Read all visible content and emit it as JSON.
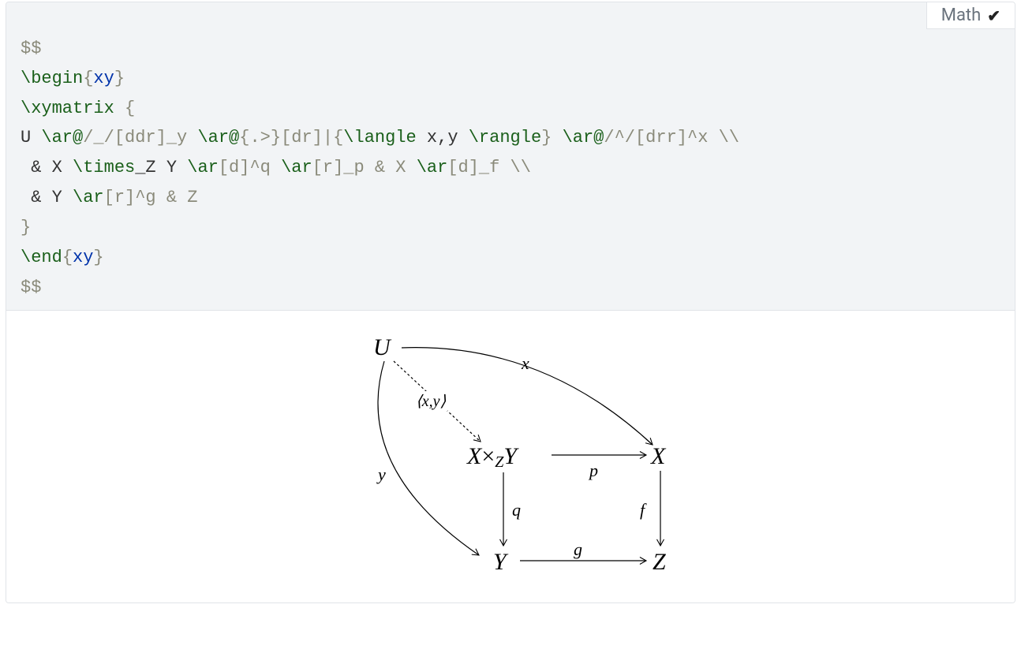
{
  "tab": {
    "label": "Math",
    "check": "✔"
  },
  "code": {
    "l1": "$$",
    "l2_begin": "\\begin",
    "l2_brace_o": "{",
    "l2_env": "xy",
    "l2_brace_c": "}",
    "l3_cmd": "\\xymatrix ",
    "l3_brace_o": "{",
    "l4_a": "U ",
    "l4_cmd1": "\\ar@",
    "l4_b": "/_/[ddr]_y ",
    "l4_cmd2": "\\ar@",
    "l4_c": "{.>}[dr]|{",
    "l4_cmd3": "\\langle",
    "l4_d": " x,y ",
    "l4_cmd4": "\\rangle",
    "l4_e": "} ",
    "l4_cmd5": "\\ar@",
    "l4_f": "/^/[drr]^x ",
    "l4_bs": "\\\\",
    "l5_a": " & X ",
    "l5_cmd1": "\\times",
    "l5_b": "_Z Y ",
    "l5_cmd2": "\\ar",
    "l5_c": "[d]^q ",
    "l5_cmd3": "\\ar",
    "l5_d": "[r]_p & X ",
    "l5_cmd4": "\\ar",
    "l5_e": "[d]_f ",
    "l5_bs": "\\\\",
    "l6_a": " & Y ",
    "l6_cmd1": "\\ar",
    "l6_b": "[r]^g & Z",
    "l7_brace_c": "}",
    "l8_end": "\\end",
    "l8_brace_o": "{",
    "l8_env": "xy",
    "l8_brace_c": "}",
    "l9": "$$"
  },
  "diagram": {
    "nodes": {
      "U": "U",
      "XZY_X": "X",
      "XZY_times": "×",
      "XZY_Z": "Z",
      "XZY_Y": "Y",
      "X": "X",
      "Y": "Y",
      "Z": "Z"
    },
    "labels": {
      "x": "x",
      "y": "y",
      "xy": "⟨x,y⟩",
      "p": "p",
      "q": "q",
      "f": "f",
      "g": "g"
    }
  }
}
